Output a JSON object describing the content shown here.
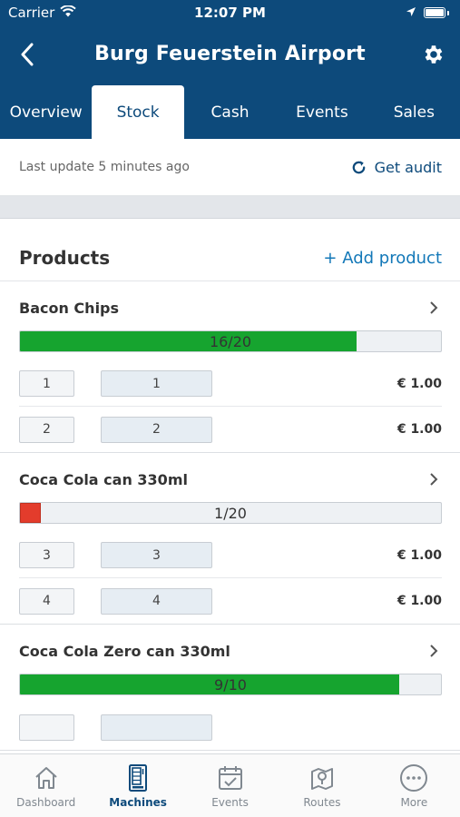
{
  "status_bar": {
    "carrier": "Carrier",
    "time": "12:07 PM"
  },
  "nav": {
    "title": "Burg Feuerstein Airport"
  },
  "tabs": [
    {
      "label": "Overview",
      "active": false
    },
    {
      "label": "Stock",
      "active": true
    },
    {
      "label": "Cash",
      "active": false
    },
    {
      "label": "Events",
      "active": false
    },
    {
      "label": "Sales",
      "active": false
    }
  ],
  "update": {
    "text": "Last update 5 minutes ago",
    "audit_label": "Get audit"
  },
  "products_section": {
    "title": "Products",
    "add_label": "+ Add product"
  },
  "products": [
    {
      "name": "Bacon Chips",
      "stock_label": "16/20",
      "stock_fraction": 0.8,
      "status": "green",
      "slots": [
        {
          "a": "1",
          "b": "1",
          "price": "€ 1.00"
        },
        {
          "a": "2",
          "b": "2",
          "price": "€ 1.00"
        }
      ]
    },
    {
      "name": "Coca Cola can 330ml",
      "stock_label": "1/20",
      "stock_fraction": 0.05,
      "status": "red",
      "slots": [
        {
          "a": "3",
          "b": "3",
          "price": "€ 1.00"
        },
        {
          "a": "4",
          "b": "4",
          "price": "€ 1.00"
        }
      ]
    },
    {
      "name": "Coca Cola Zero can 330ml",
      "stock_label": "9/10",
      "stock_fraction": 0.9,
      "status": "green",
      "slots": [
        {
          "a": "",
          "b": "",
          "price": ""
        }
      ]
    }
  ],
  "bottom_tabs": [
    {
      "label": "Dashboard",
      "icon": "house-icon",
      "active": false
    },
    {
      "label": "Machines",
      "icon": "vending-machine-icon",
      "active": true
    },
    {
      "label": "Events",
      "icon": "calendar-icon",
      "active": false
    },
    {
      "label": "Routes",
      "icon": "map-pin-icon",
      "active": false
    },
    {
      "label": "More",
      "icon": "more-dots-icon",
      "active": false
    }
  ],
  "colors": {
    "header": "#0d4a7b",
    "link": "#1378b8",
    "green": "#16a42f",
    "red": "#e33c2c"
  }
}
